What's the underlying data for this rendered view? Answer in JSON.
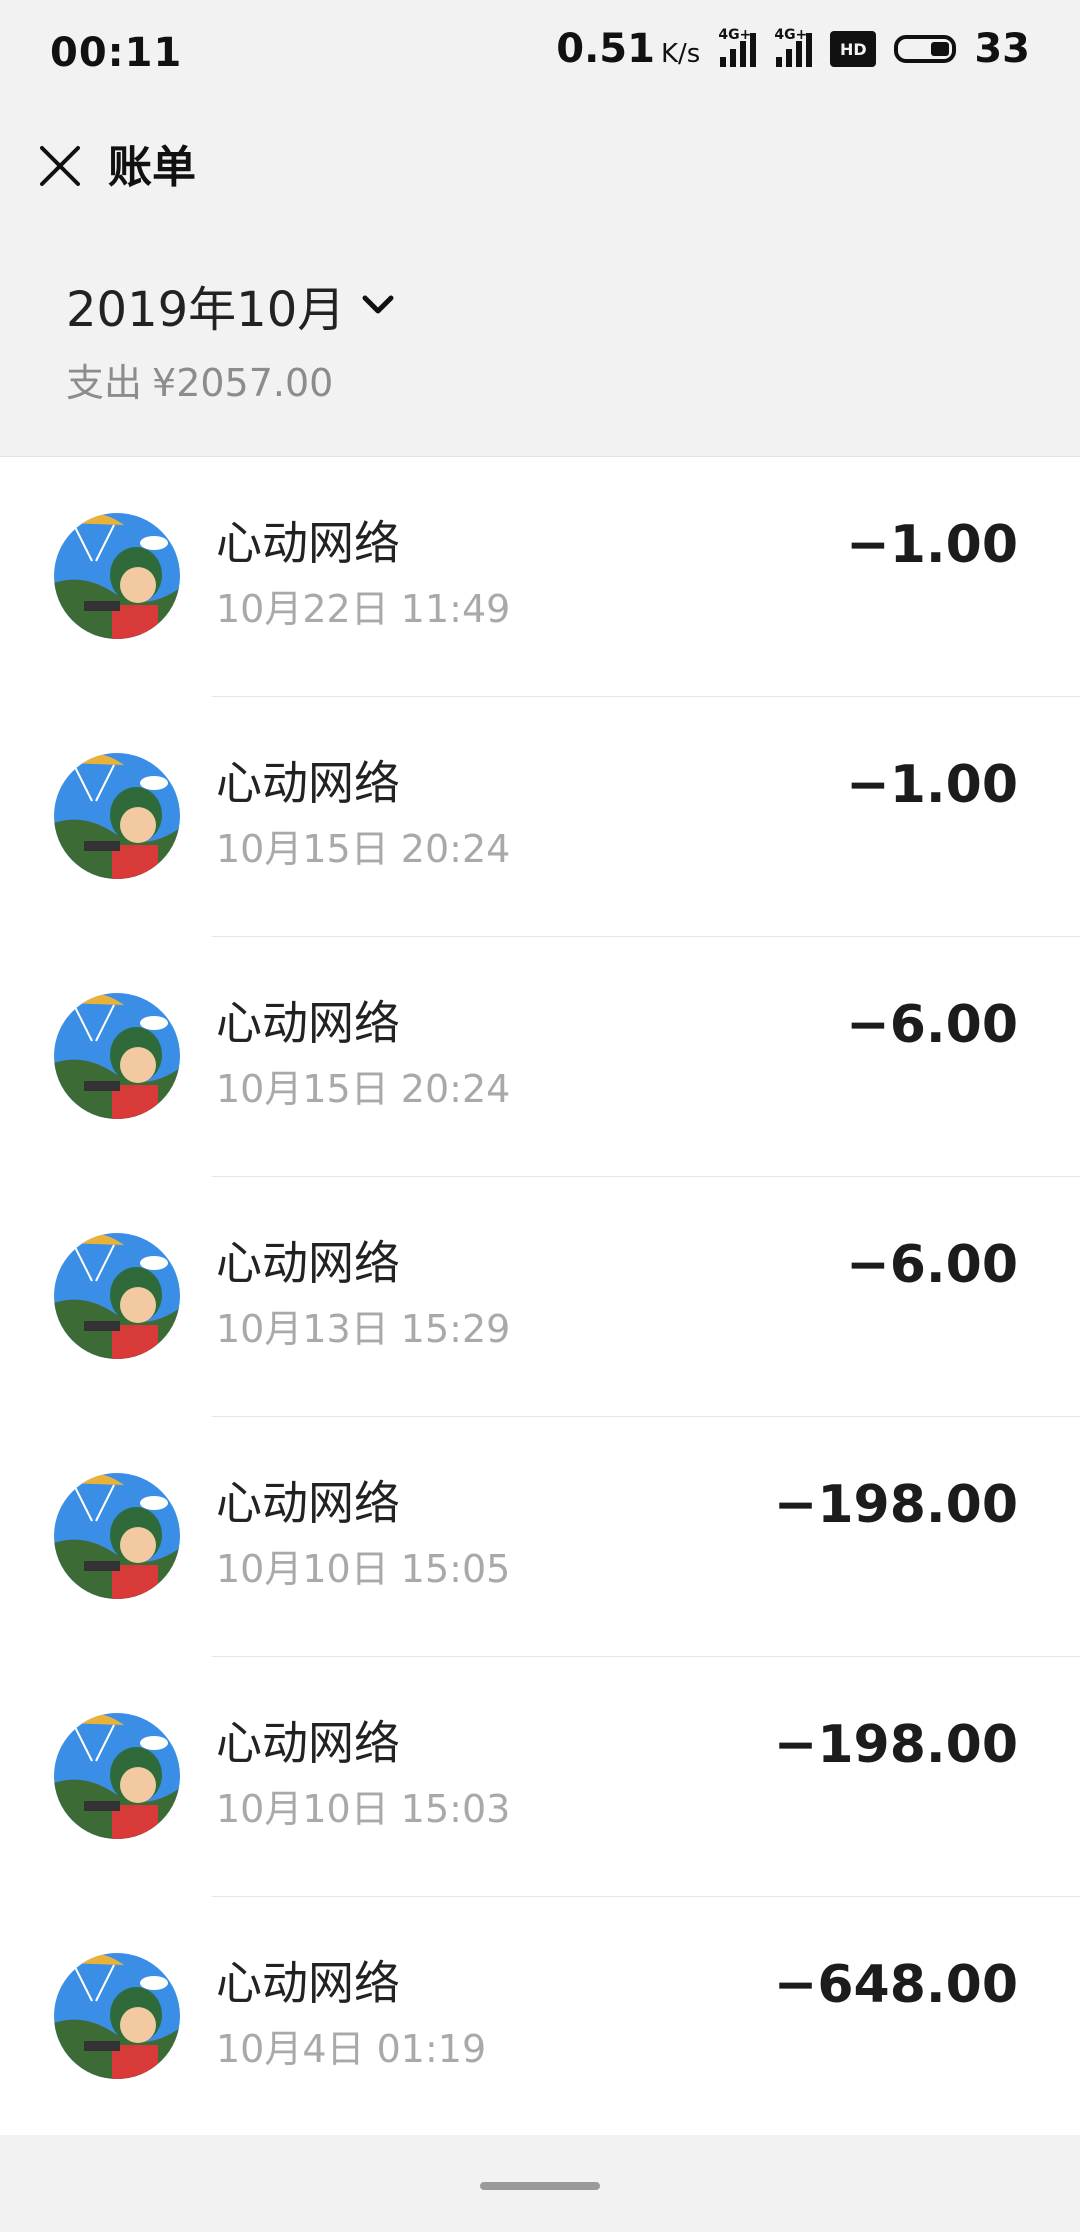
{
  "status_bar": {
    "time": "00:11",
    "net_speed": "0.51",
    "net_unit": "K/s",
    "sim1": "4G+",
    "sim2": "4G+",
    "hd": "HD",
    "battery": "33"
  },
  "nav": {
    "title": "账单",
    "close_icon": "close-icon"
  },
  "summary": {
    "month": "2019年10月",
    "expense_label": "支出",
    "expense_amount": "¥2057.00"
  },
  "transactions": [
    {
      "merchant": "心动网络",
      "time": "10月22日 11:49",
      "amount": "−1.00"
    },
    {
      "merchant": "心动网络",
      "time": "10月15日 20:24",
      "amount": "−1.00"
    },
    {
      "merchant": "心动网络",
      "time": "10月15日 20:24",
      "amount": "−6.00"
    },
    {
      "merchant": "心动网络",
      "time": "10月13日 15:29",
      "amount": "−6.00"
    },
    {
      "merchant": "心动网络",
      "time": "10月10日 15:05",
      "amount": "−198.00"
    },
    {
      "merchant": "心动网络",
      "time": "10月10日 15:03",
      "amount": "−198.00"
    },
    {
      "merchant": "心动网络",
      "time": "10月4日 01:19",
      "amount": "−648.00"
    }
  ],
  "colors": {
    "background": "#f2f2f2",
    "list_background": "#ffffff",
    "secondary_text": "#a9a9a9"
  }
}
